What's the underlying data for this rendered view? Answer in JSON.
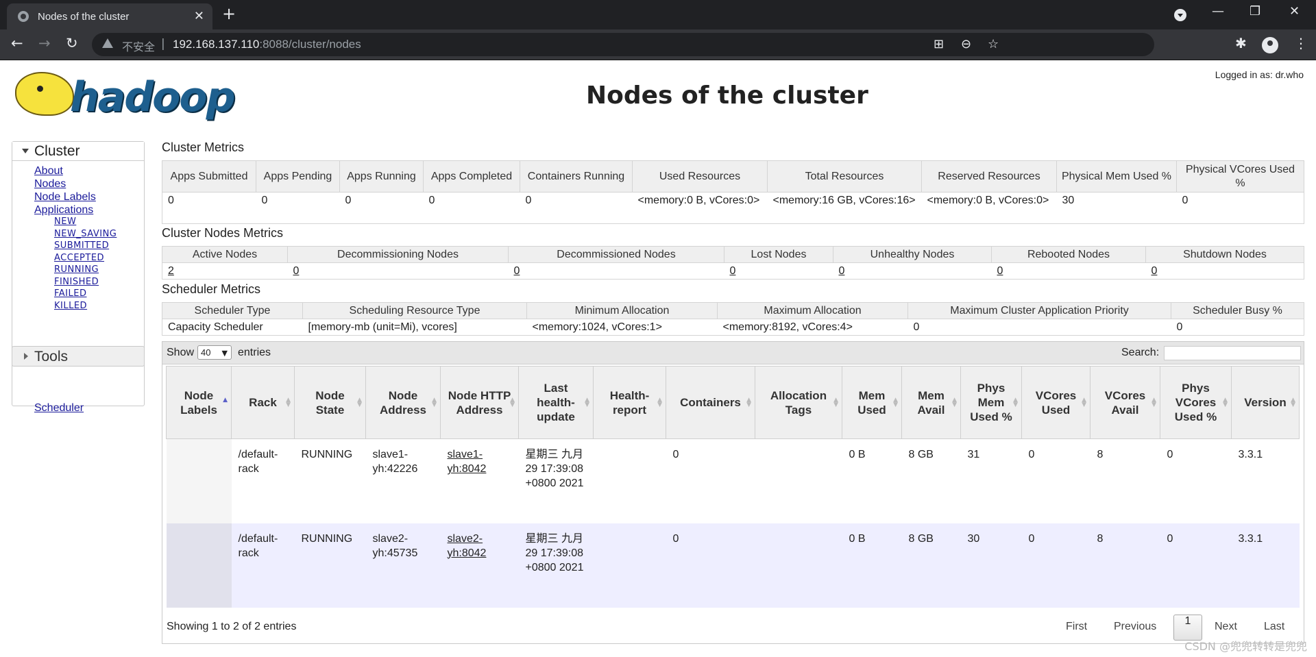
{
  "browser": {
    "tab_title": "Nodes of the cluster",
    "tab_close": "✕",
    "new_tab": "+",
    "window_controls": [
      "—",
      "❐",
      "✕"
    ],
    "nav": {
      "back": "←",
      "forward": "→",
      "reload": "↻"
    },
    "omnibox": {
      "security_label": "不安全",
      "separator": "|",
      "url_host": "192.168.137.110",
      "url_rest": ":8088/cluster/nodes"
    },
    "icons": [
      "translate-icon",
      "zoom-icon",
      "star-icon",
      "extensions-icon",
      "profile-icon",
      "menu-icon"
    ]
  },
  "header": {
    "logo_text": "hadoop",
    "page_title": "Nodes of the cluster",
    "logged_in": "Logged in as: dr.who"
  },
  "sidebar": {
    "cluster_label": "Cluster",
    "links": [
      "About",
      "Nodes",
      "Node Labels",
      "Applications"
    ],
    "app_states": [
      "NEW",
      "NEW_SAVING",
      "SUBMITTED",
      "ACCEPTED",
      "RUNNING",
      "FINISHED",
      "FAILED",
      "KILLED"
    ],
    "scheduler": "Scheduler",
    "tools_label": "Tools"
  },
  "cluster_metrics": {
    "title": "Cluster Metrics",
    "headers": [
      "Apps Submitted",
      "Apps Pending",
      "Apps Running",
      "Apps Completed",
      "Containers Running",
      "Used Resources",
      "Total Resources",
      "Reserved Resources",
      "Physical Mem Used %",
      "Physical VCores Used %"
    ],
    "values": [
      "0",
      "0",
      "0",
      "0",
      "0",
      "<memory:0 B, vCores:0>",
      "<memory:16 GB, vCores:16>",
      "<memory:0 B, vCores:0>",
      "30",
      "0"
    ]
  },
  "node_metrics": {
    "title": "Cluster Nodes Metrics",
    "headers": [
      "Active Nodes",
      "Decommissioning Nodes",
      "Decommissioned Nodes",
      "Lost Nodes",
      "Unhealthy Nodes",
      "Rebooted Nodes",
      "Shutdown Nodes"
    ],
    "values": [
      "2",
      "0",
      "0",
      "0",
      "0",
      "0",
      "0"
    ]
  },
  "scheduler_metrics": {
    "title": "Scheduler Metrics",
    "headers": [
      "Scheduler Type",
      "Scheduling Resource Type",
      "Minimum Allocation",
      "Maximum Allocation",
      "Maximum Cluster Application Priority",
      "Scheduler Busy %"
    ],
    "values": [
      "Capacity Scheduler",
      "[memory-mb (unit=Mi), vcores]",
      "<memory:1024, vCores:1>",
      "<memory:8192, vCores:4>",
      "0",
      "0"
    ]
  },
  "nodes_table": {
    "show_label": "Show",
    "page_size": "40",
    "entries_label": "entries",
    "search_label": "Search:",
    "search_value": "",
    "headers": [
      "Node Labels",
      "Rack",
      "Node State",
      "Node Address",
      "Node HTTP Address",
      "Last health-update",
      "Health-report",
      "Containers",
      "Allocation Tags",
      "Mem Used",
      "Mem Avail",
      "Phys Mem Used %",
      "VCores Used",
      "VCores Avail",
      "Phys VCores Used %",
      "Version"
    ],
    "rows": [
      {
        "node_labels": "",
        "rack": "/default-rack",
        "state": "RUNNING",
        "address": "slave1-yh:42226",
        "http_address": "slave1-yh:8042",
        "last_health_update": "星期三 九月 29 17:39:08 +0800 2021",
        "health_report": "",
        "containers": "0",
        "allocation_tags": "",
        "mem_used": "0 B",
        "mem_avail": "8 GB",
        "phys_mem_used": "31",
        "vcores_used": "0",
        "vcores_avail": "8",
        "phys_vcores_used": "0",
        "version": "3.3.1"
      },
      {
        "node_labels": "",
        "rack": "/default-rack",
        "state": "RUNNING",
        "address": "slave2-yh:45735",
        "http_address": "slave2-yh:8042",
        "last_health_update": "星期三 九月 29 17:39:08 +0800 2021",
        "health_report": "",
        "containers": "0",
        "allocation_tags": "",
        "mem_used": "0 B",
        "mem_avail": "8 GB",
        "phys_mem_used": "30",
        "vcores_used": "0",
        "vcores_avail": "8",
        "phys_vcores_used": "0",
        "version": "3.3.1"
      }
    ],
    "info": "Showing 1 to 2 of 2 entries",
    "pagination": {
      "first": "First",
      "previous": "Previous",
      "current": "1",
      "next": "Next",
      "last": "Last"
    }
  },
  "watermark": "CSDN @兜兜转转是兜兜"
}
